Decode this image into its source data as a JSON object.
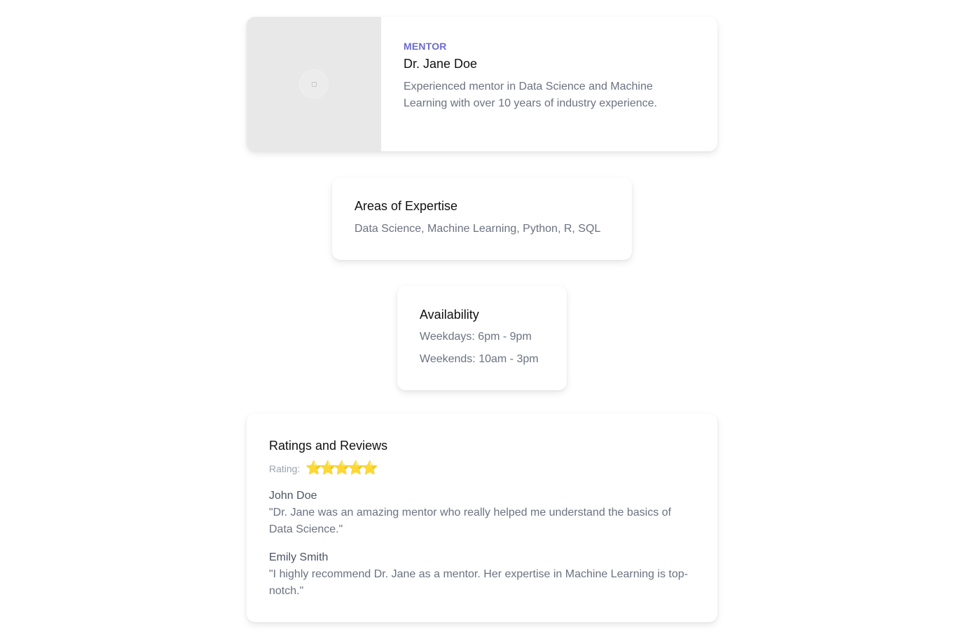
{
  "mentor": {
    "eyebrow": "MENTOR",
    "name": "Dr. Jane Doe",
    "description": "Experienced mentor in Data Science and Machine Learning with over 10 years of industry experience.",
    "image_icon": "image-placeholder-icon"
  },
  "expertise": {
    "title": "Areas of Expertise",
    "text": "Data Science, Machine Learning, Python, R, SQL"
  },
  "availability": {
    "title": "Availability",
    "lines": [
      "Weekdays: 6pm - 9pm",
      "Weekends: 10am - 3pm"
    ]
  },
  "reviews": {
    "title": "Ratings and Reviews",
    "rating_label": "Rating:",
    "stars": [
      "⭐",
      "⭐",
      "⭐",
      "⭐",
      "⭐"
    ],
    "star_icon": "star-icon",
    "items": [
      {
        "author": "John Doe",
        "text": "\"Dr. Jane was an amazing mentor who really helped me understand the basics of Data Science.\""
      },
      {
        "author": "Emily Smith",
        "text": "\"I highly recommend Dr. Jane as a mentor. Her expertise in Machine Learning is top-notch.\""
      }
    ]
  },
  "colors": {
    "accent": "#6b6bcf",
    "star": "#fbbf24",
    "muted_text": "#6b7280"
  }
}
